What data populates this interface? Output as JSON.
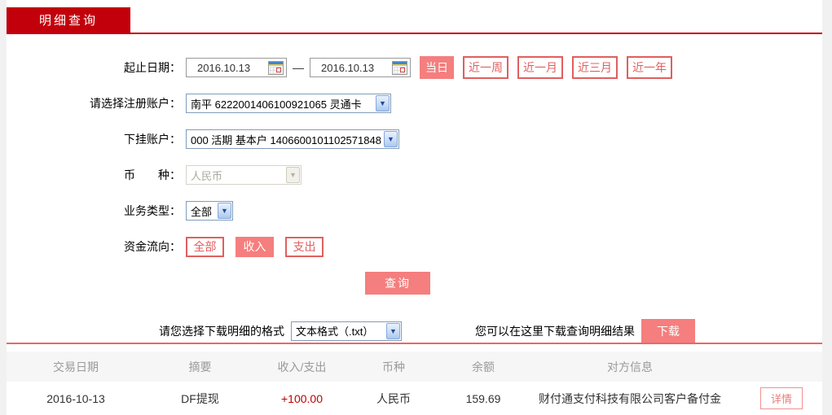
{
  "tab": {
    "label": "明细查询"
  },
  "colors": {
    "accent_red": "#c2000b",
    "button_fill": "#f57e7e",
    "button_outline": "#e05f5f",
    "amount_red": "#c00000",
    "divider": "#ed6666",
    "table_header_bg": "#f6f6f6"
  },
  "form": {
    "date_label": "起止日期：",
    "date_start": "2016.10.13",
    "date_end": "2016.10.13",
    "date_separator": "—",
    "quick_ranges": [
      {
        "label": "当日"
      },
      {
        "label": "近一周"
      },
      {
        "label": "近一月"
      },
      {
        "label": "近三月"
      },
      {
        "label": "近一年"
      }
    ],
    "register_account_label": "请选择注册账户：",
    "register_account_value": "南平 6222001406100921065 灵通卡",
    "sub_account_label": "下挂账户：",
    "sub_account_value": "000 活期 基本户 1406600101102571848",
    "currency_label": "币　　种：",
    "currency_value": "人民币",
    "business_type_label": "业务类型：",
    "business_type_value": "全部",
    "fund_flow_label": "资金流向：",
    "fund_flow_options": [
      {
        "label": "全部"
      },
      {
        "label": "收入"
      },
      {
        "label": "支出"
      }
    ],
    "query_button": "查询",
    "select_arrow": "▼"
  },
  "download": {
    "format_label": "请您选择下载明细的格式",
    "format_value": "文本格式（.txt）",
    "hint": "您可以在这里下载查询明细结果",
    "button": "下载"
  },
  "table": {
    "headers": [
      "交易日期",
      "摘要",
      "收入/支出",
      "币种",
      "余额",
      "对方信息"
    ],
    "rows": [
      {
        "date": "2016-10-13",
        "summary": "DF提现",
        "amount": "+100.00",
        "currency": "人民币",
        "balance": "159.69",
        "counterparty": "财付通支付科技有限公司客户备付金",
        "action": "详情"
      }
    ]
  }
}
